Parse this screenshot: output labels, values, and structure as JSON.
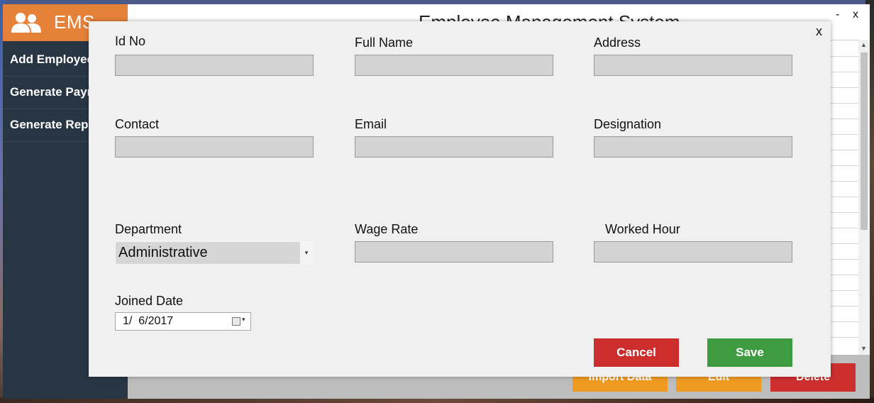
{
  "app": {
    "brand": "EMS",
    "title": "Employee Management System",
    "minimize_glyph": "-",
    "close_glyph": "x"
  },
  "sidebar": {
    "items": [
      {
        "label": "Add Employee"
      },
      {
        "label": "Generate Payroll"
      },
      {
        "label": "Generate Report"
      }
    ]
  },
  "toolbar": {
    "import_label": "Import Data",
    "edit_label": "Edit",
    "delete_label": "Delete"
  },
  "dialog": {
    "close_glyph": "x",
    "fields": {
      "id_no": {
        "label": "Id No",
        "value": ""
      },
      "full_name": {
        "label": "Full Name",
        "value": ""
      },
      "address": {
        "label": "Address",
        "value": ""
      },
      "contact": {
        "label": "Contact",
        "value": ""
      },
      "email": {
        "label": "Email",
        "value": ""
      },
      "designation": {
        "label": "Designation",
        "value": ""
      },
      "department": {
        "label": "Department",
        "value": "Administrative"
      },
      "wage_rate": {
        "label": "Wage Rate",
        "value": ""
      },
      "worked_hour": {
        "label": "Worked Hour",
        "value": ""
      },
      "joined_date": {
        "label": "Joined Date",
        "value": "1/  6/2017"
      }
    },
    "cancel_label": "Cancel",
    "save_label": "Save"
  },
  "colors": {
    "brand": "#e6813a",
    "sidebar": "#283543",
    "cancel": "#cc2e2e",
    "save": "#3f9b3f",
    "import": "#ef9a22",
    "edit": "#ef9a22",
    "delete": "#cc2e2e"
  },
  "icons": {
    "brand": "users-icon",
    "calendar": "calendar-icon",
    "dropdown": "chevron-down-icon"
  }
}
